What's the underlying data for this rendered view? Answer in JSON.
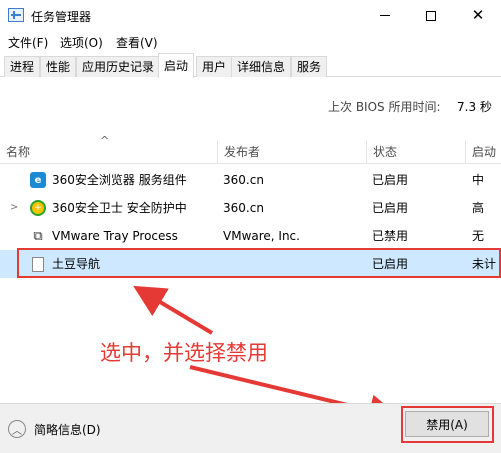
{
  "window": {
    "title": "任务管理器"
  },
  "menu": [
    "文件(F)",
    "选项(O)",
    "查看(V)"
  ],
  "tabs": [
    "进程",
    "性能",
    "应用历史记录",
    "启动",
    "用户",
    "详细信息",
    "服务"
  ],
  "bios": {
    "label": "上次 BIOS 所用时间:",
    "value": "7.3 秒"
  },
  "columns": [
    "名称",
    "发布者",
    "状态",
    "启动"
  ],
  "sort_indicator": "^",
  "rows": [
    {
      "name": "360安全浏览器 服务组件",
      "publisher": "360.cn",
      "status": "已启用",
      "impact": "中",
      "icon": "360-browser-icon",
      "expandable": false
    },
    {
      "name": "360安全卫士 安全防护中",
      "publisher": "360.cn",
      "status": "已启用",
      "impact": "高",
      "icon": "360-safe-icon",
      "expandable": true
    },
    {
      "name": "VMware Tray Process",
      "publisher": "VMware, Inc.",
      "status": "已禁用",
      "impact": "无",
      "icon": "vmware-icon",
      "expandable": false
    },
    {
      "name": "土豆导航",
      "publisher": "",
      "status": "已启用",
      "impact": "未计",
      "icon": "document-icon",
      "expandable": false
    }
  ],
  "annotation": "选中，并选择禁用",
  "footer": {
    "collapse_label": "简略信息(D)",
    "disable_button": "禁用(A)"
  },
  "colors": {
    "selection": "#cde8ff",
    "annotation_red": "#e53935"
  }
}
